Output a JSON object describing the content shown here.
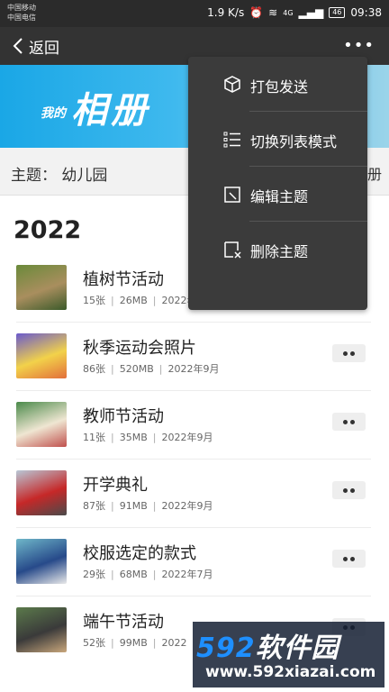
{
  "status_bar": {
    "carrier1": "中国移动",
    "carrier2": "中国电信",
    "speed": "1.9 K/s",
    "network": "4G",
    "battery": "46",
    "time": "09:38"
  },
  "top_bar": {
    "back_label": "返回",
    "more_label": "•••"
  },
  "banner": {
    "small_text": "我的",
    "big_text": "相册"
  },
  "subject": {
    "label": "主题：  幼儿园",
    "right_text": "册"
  },
  "year": "2022",
  "albums": [
    {
      "title": "植树节活动",
      "count": "15张",
      "size": "26MB",
      "date": "2022年",
      "colors": [
        "#6a8a3a",
        "#a98e5e",
        "#3b5a2a"
      ]
    },
    {
      "title": "秋季运动会照片",
      "count": "86张",
      "size": "520MB",
      "date": "2022年9月",
      "colors": [
        "#6a5acd",
        "#f2d24a",
        "#e26f3b"
      ]
    },
    {
      "title": "教师节活动",
      "count": "11张",
      "size": "35MB",
      "date": "2022年9月",
      "colors": [
        "#4a8a4a",
        "#efe6d2",
        "#c0504d"
      ]
    },
    {
      "title": "开学典礼",
      "count": "87张",
      "size": "91MB",
      "date": "2022年9月",
      "colors": [
        "#b8c7d6",
        "#c62828",
        "#4a4a4a"
      ]
    },
    {
      "title": "校服选定的款式",
      "count": "29张",
      "size": "68MB",
      "date": "2022年7月",
      "colors": [
        "#6fb7c9",
        "#274a8a",
        "#e9e9e9"
      ]
    },
    {
      "title": "端午节活动",
      "count": "52张",
      "size": "99MB",
      "date": "2022",
      "colors": [
        "#5b7a4b",
        "#3a3a3a",
        "#c9a77c"
      ]
    }
  ],
  "menu": {
    "items": [
      {
        "label": "打包发送",
        "icon": "package-icon"
      },
      {
        "label": "切换列表模式",
        "icon": "list-icon"
      },
      {
        "label": "编辑主题",
        "icon": "edit-icon"
      },
      {
        "label": "删除主题",
        "icon": "delete-icon"
      }
    ]
  },
  "watermark": {
    "brand_num": "592",
    "brand_text": "软件园",
    "url": "www.592xiazai.com"
  }
}
